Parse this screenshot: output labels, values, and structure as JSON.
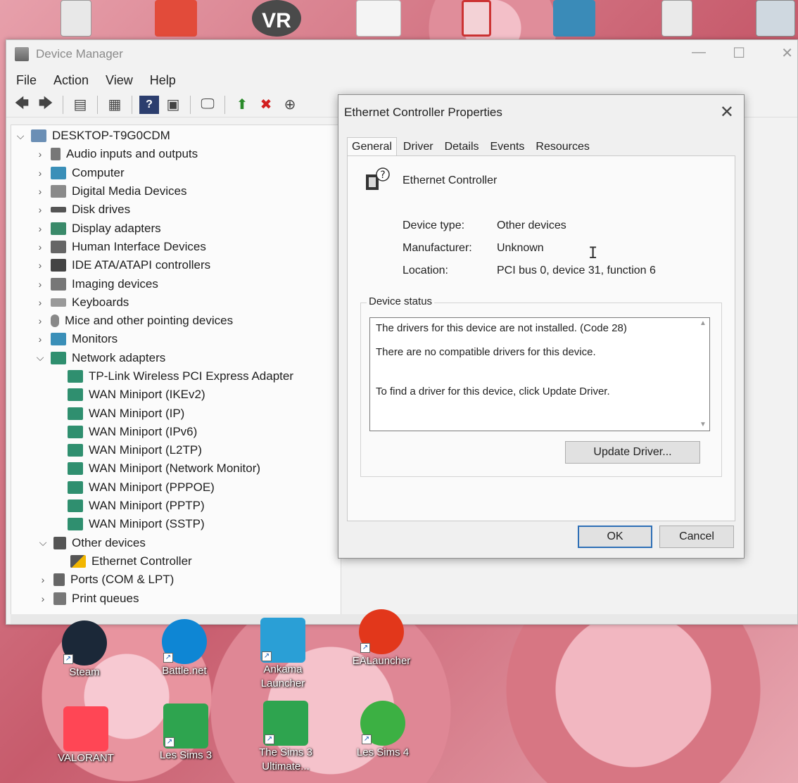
{
  "desktop": {
    "bottom_icons": [
      {
        "label": "Steam",
        "color": "#1b2838"
      },
      {
        "label": "Battle.net",
        "color": "#0e86d4"
      },
      {
        "label": "Ankama Launcher",
        "color": "#2a9fd6"
      },
      {
        "label": "EALauncher",
        "color": "#e2371b"
      },
      {
        "label": "VALORANT",
        "color": "#ff4655"
      },
      {
        "label": "Les Sims 3",
        "color": "#2ea44f"
      },
      {
        "label": "The Sims 3 Ultimate...",
        "color": "#2ea44f"
      },
      {
        "label": "Les Sims 4",
        "color": "#3cb043"
      }
    ],
    "top_icons_text": {
      "vr": "VR"
    }
  },
  "device_manager": {
    "title": "Device Manager",
    "menu": [
      "File",
      "Action",
      "View",
      "Help"
    ],
    "tree": {
      "root": "DESKTOP-T9G0CDM",
      "categories": [
        "Audio inputs and outputs",
        "Computer",
        "Digital Media Devices",
        "Disk drives",
        "Display adapters",
        "Human Interface Devices",
        "IDE ATA/ATAPI controllers",
        "Imaging devices",
        "Keyboards",
        "Mice and other pointing devices",
        "Monitors"
      ],
      "network_adapters": {
        "label": "Network adapters",
        "children": [
          "TP-Link Wireless PCI Express Adapter",
          "WAN Miniport (IKEv2)",
          "WAN Miniport (IP)",
          "WAN Miniport (IPv6)",
          "WAN Miniport (L2TP)",
          "WAN Miniport (Network Monitor)",
          "WAN Miniport (PPPOE)",
          "WAN Miniport (PPTP)",
          "WAN Miniport (SSTP)"
        ]
      },
      "other_devices": {
        "label": "Other devices",
        "children": [
          "Ethernet Controller"
        ]
      },
      "after": [
        "Ports (COM & LPT)",
        "Print queues"
      ]
    }
  },
  "dialog": {
    "title": "Ethernet Controller Properties",
    "tabs": [
      "General",
      "Driver",
      "Details",
      "Events",
      "Resources"
    ],
    "active_tab": "General",
    "device_name": "Ethernet Controller",
    "device_type_label": "Device type:",
    "device_type": "Other devices",
    "manufacturer_label": "Manufacturer:",
    "manufacturer": "Unknown",
    "location_label": "Location:",
    "location": "PCI bus 0, device 31, function 6",
    "status_legend": "Device status",
    "status_lines": [
      "The drivers for this device are not installed. (Code 28)",
      "There are no compatible drivers for this device.",
      "To find a driver for this device, click Update Driver."
    ],
    "update_driver_label": "Update Driver...",
    "ok_label": "OK",
    "cancel_label": "Cancel"
  }
}
